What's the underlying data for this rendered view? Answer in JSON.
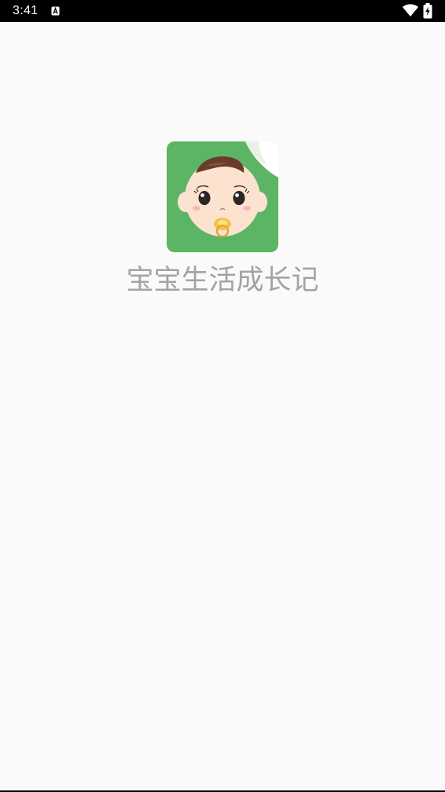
{
  "status_bar": {
    "time": "3:41",
    "notification_icon": "a-icon",
    "wifi_icon": "wifi-icon",
    "battery_icon": "battery-charging-icon"
  },
  "splash": {
    "logo_icon": "baby-face-logo-icon",
    "app_name": "宝宝生活成长记"
  },
  "colors": {
    "background": "#fafafa",
    "status_bar": "#000000",
    "logo_green": "#5cb564",
    "title_gray": "#a3a3a3"
  }
}
